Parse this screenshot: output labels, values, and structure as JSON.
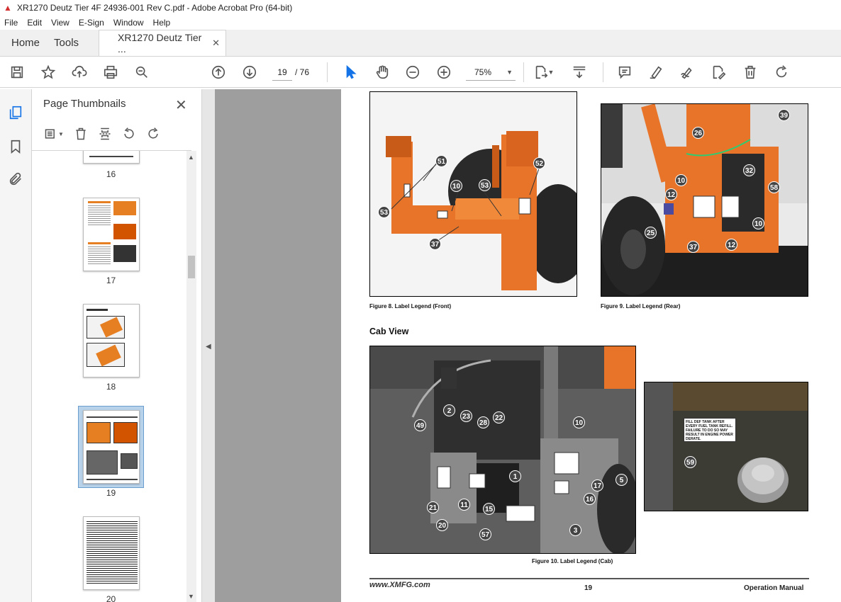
{
  "window": {
    "title": "XR1270 Deutz Tier 4F 24936-001 Rev C.pdf - Adobe Acrobat Pro (64-bit)"
  },
  "menu": [
    "File",
    "Edit",
    "View",
    "E-Sign",
    "Window",
    "Help"
  ],
  "tabs": {
    "home": "Home",
    "tools": "Tools",
    "document": "XR1270 Deutz Tier ..."
  },
  "toolbar": {
    "page_current": "19",
    "page_total": "/ 76",
    "zoom": "75%"
  },
  "thumbnails_panel": {
    "title": "Page Thumbnails",
    "pages": [
      {
        "label": "16"
      },
      {
        "label": "17"
      },
      {
        "label": "18"
      },
      {
        "label": "19",
        "selected": true
      },
      {
        "label": "20"
      }
    ]
  },
  "document_page": {
    "figures": [
      {
        "caption": "Figure 8. Label Legend (Front)",
        "callouts": [
          "51",
          "52",
          "53",
          "10",
          "53",
          "37"
        ]
      },
      {
        "caption": "Figure 9. Label Legend (Rear)",
        "callouts": [
          "39",
          "26",
          "10",
          "32",
          "58",
          "12",
          "25",
          "10",
          "37",
          "12"
        ]
      },
      {
        "caption": "Figure 10. Label Legend (Cab)",
        "callouts": [
          "2",
          "23",
          "28",
          "22",
          "10",
          "49",
          "1",
          "17",
          "5",
          "21",
          "11",
          "15",
          "16",
          "20",
          "57",
          "3"
        ]
      }
    ],
    "section_heading": "Cab View",
    "decal_text": "FILL DEF TANK AFTER EVERY FUEL TANK REFILL. FAILURE TO DO SO MAY RESULT IN ENGINE POWER DERATE.",
    "decal_callout": "59",
    "footer": {
      "logo": "www.XMFG.com",
      "page_number": "19",
      "title": "Operation Manual"
    }
  }
}
